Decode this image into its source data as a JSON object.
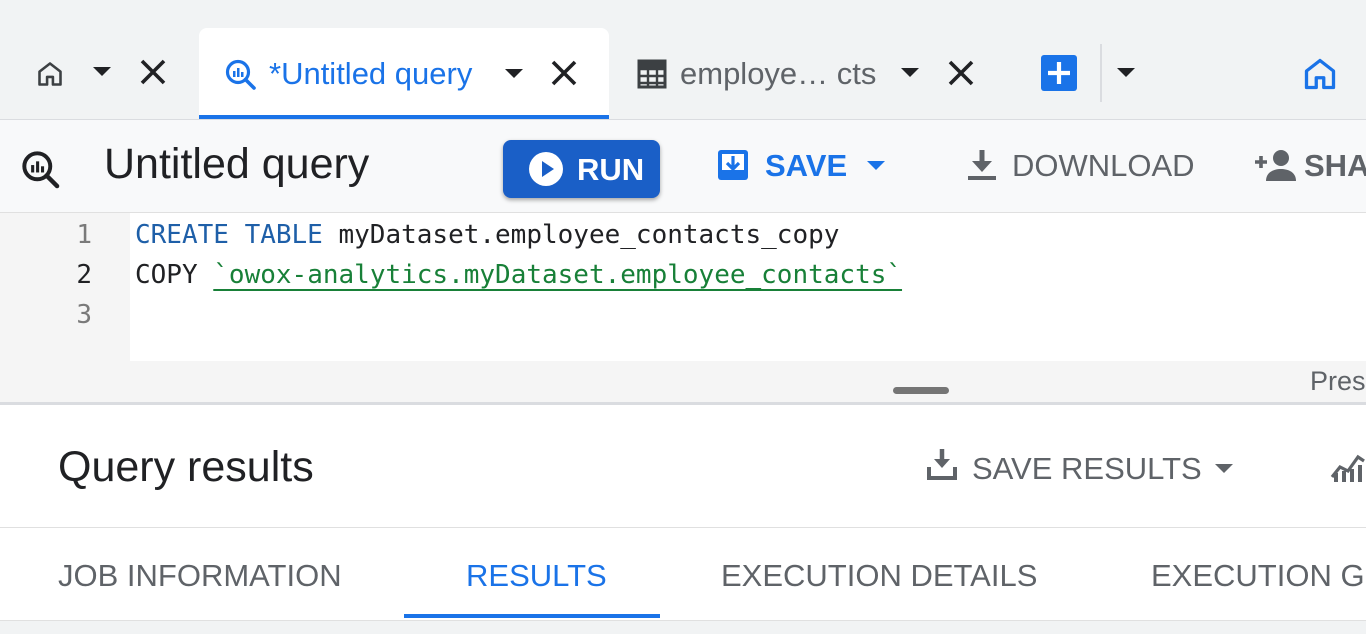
{
  "tabs": [
    {
      "label": "",
      "icon": "home-icon"
    },
    {
      "label": "*Untitled query",
      "icon": "query-icon",
      "active": true
    },
    {
      "label": "employe… cts",
      "icon": "table-icon"
    }
  ],
  "toolbar": {
    "title": "Untitled query",
    "run_label": "RUN",
    "save_label": "SAVE",
    "download_label": "DOWNLOAD",
    "share_label": "SHA"
  },
  "editor": {
    "line_numbers": [
      "1",
      "2",
      "3"
    ],
    "lines": {
      "l1_keywords": "CREATE TABLE",
      "l1_rest": " myDataset.employee_contacts_copy",
      "l2_keyword": "COPY",
      "l2_string": "`owox-analytics.myDataset.employee_contacts`"
    },
    "hint": "Pres"
  },
  "results": {
    "title": "Query results",
    "save_results_label": "SAVE RESULTS",
    "tabs": [
      "JOB INFORMATION",
      "RESULTS",
      "EXECUTION DETAILS",
      "EXECUTION GR"
    ],
    "active_tab": "RESULTS"
  },
  "colors": {
    "accent": "#1a73e8",
    "run_button": "#1a5fc7",
    "keyword": "#1e5fa8",
    "string": "#188038"
  }
}
